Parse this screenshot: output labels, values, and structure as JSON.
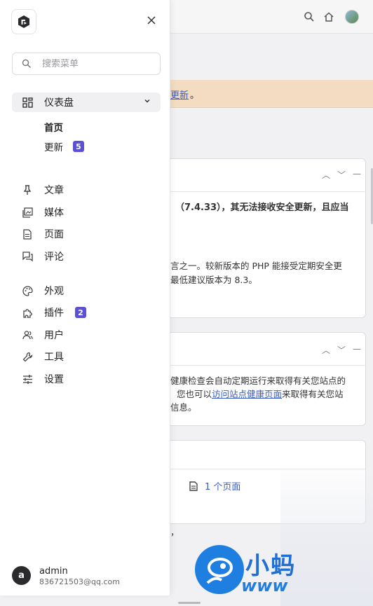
{
  "drawer": {
    "search_placeholder": "搜索菜单",
    "dashboard": {
      "label": "仪表盘",
      "sub_items": [
        {
          "label": "首页"
        },
        {
          "label": "更新",
          "badge": "5"
        }
      ]
    },
    "menu_group1": [
      {
        "label": "文章",
        "icon": "pin-icon"
      },
      {
        "label": "媒体",
        "icon": "media-icon"
      },
      {
        "label": "页面",
        "icon": "page-icon"
      },
      {
        "label": "评论",
        "icon": "comment-icon"
      }
    ],
    "menu_group2": [
      {
        "label": "外观",
        "icon": "palette-icon"
      },
      {
        "label": "插件",
        "icon": "plugin-icon",
        "badge": "2"
      },
      {
        "label": "用户",
        "icon": "users-icon"
      },
      {
        "label": "工具",
        "icon": "wrench-icon"
      },
      {
        "label": "设置",
        "icon": "sliders-icon"
      }
    ],
    "user": {
      "avatar_letter": "a",
      "name": "admin",
      "email": "836721503@qq.com"
    }
  },
  "background": {
    "notice_link": "更新",
    "notice_suffix": "。",
    "php_warning": "（7.4.33），其无法接收安全更新，且应当",
    "php_line1": "言之一。较新版本的 PHP 能接受定期安全更",
    "php_line2": "最低建议版本为 8.3。",
    "health_line1": "健康检查会自动定期运行来取得有关您站点的",
    "health_line2_prefix": "您也可以",
    "health_link": "访问站点健康页面",
    "health_line2_suffix": "来取得有关您站",
    "health_line3": "信息。",
    "pages_count": "1 个页面",
    "comma": "，"
  },
  "watermark": {
    "text": "小蚂",
    "sub": "www"
  },
  "colors": {
    "badge": "#5b50d6",
    "link": "#3a5bbf",
    "notice_bg": "#f3dcc1"
  }
}
